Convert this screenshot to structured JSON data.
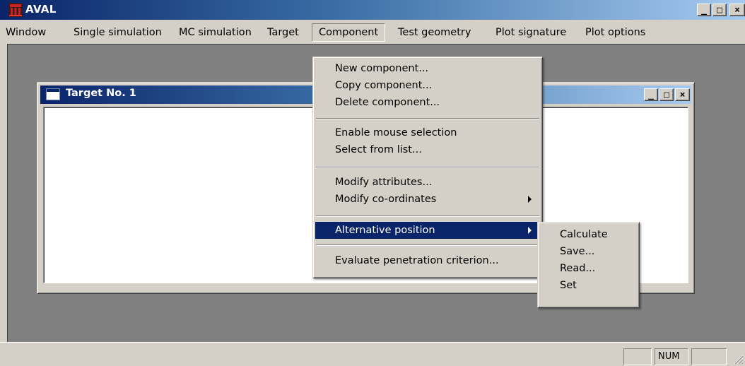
{
  "app": {
    "title": "AVAL"
  },
  "menubar": {
    "items": [
      {
        "label": "Window"
      },
      {
        "label": "Single simulation"
      },
      {
        "label": "MC simulation"
      },
      {
        "label": "Target"
      },
      {
        "label": "Component"
      },
      {
        "label": "Test geometry"
      },
      {
        "label": "Plot signature"
      },
      {
        "label": "Plot options"
      }
    ],
    "open_item": "Component"
  },
  "child_window": {
    "title": "Target No. 1"
  },
  "component_menu": {
    "groups": [
      [
        "New component...",
        "Copy component...",
        "Delete component..."
      ],
      [
        "Enable mouse selection",
        "Select from list..."
      ],
      [
        "Modify attributes...",
        "Modify co-ordinates"
      ],
      [
        "Alternative position"
      ],
      [
        "Evaluate penetration criterion..."
      ]
    ],
    "highlighted": "Alternative position",
    "has_submenu": [
      "Modify co-ordinates",
      "Alternative position"
    ]
  },
  "alternative_position_menu": {
    "items": [
      "Calculate",
      "Save...",
      "Read...",
      "Set"
    ]
  },
  "statusbar": {
    "panes": [
      "",
      "NUM",
      ""
    ]
  },
  "colors": {
    "title_active_start": "#0a246a",
    "title_active_end": "#a6caf0",
    "face": "#d4d0c8",
    "mdi_background": "#808080",
    "highlight": "#0a246a"
  },
  "icons": {
    "app": "aval-app-icon",
    "child": "document-window-icon",
    "minimize": "minimize-icon",
    "maximize": "maximize-icon",
    "close": "close-icon",
    "submenu": "submenu-arrow-icon",
    "grip": "resize-grip-icon"
  }
}
